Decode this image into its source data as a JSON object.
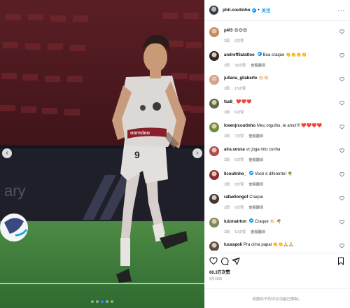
{
  "header": {
    "username": "phil.coutinho",
    "separator": "•",
    "follow_label": "关注",
    "more_label": "···"
  },
  "media": {
    "prev_label": "‹",
    "next_label": "›",
    "slide_count": 5,
    "active_slide": 3,
    "scene_colors": {
      "stands": "#4a1b21",
      "seat": "#7c2a31",
      "pitch": "#3d7a3c",
      "kit": "#d9d6d4",
      "accent": "#8a1f2c"
    }
  },
  "comments": [
    {
      "user": "p4f3",
      "verified": false,
      "text": "😍😍😍",
      "age": "2周",
      "likes": "6次赞",
      "reply": "",
      "avatar_color": "#c98c62"
    },
    {
      "user": "andreffilatattoo",
      "verified": true,
      "text": "Boa craque 👏👏👏👏",
      "age": "2周",
      "likes": "39次赞",
      "reply": "查看翻译",
      "avatar_color": "#2b2b2b"
    },
    {
      "user": "juliana_gilaberte",
      "verified": false,
      "text": "👏🏻👏🏻",
      "age": "2周",
      "likes": "15次赞",
      "reply": "",
      "avatar_color": "#d7a38b"
    },
    {
      "user": "fas8_",
      "verified": false,
      "text": "❤️❤️❤️",
      "age": "2周",
      "likes": "6次赞",
      "reply": "",
      "avatar_color": "#5c6b4a"
    },
    {
      "user": "lovenjrcoutinho",
      "verified": false,
      "text": "Meu orgulho, te amo!!!! ❤️❤️❤️❤️",
      "age": "2周",
      "likes": "7次赞",
      "reply": "查看翻译",
      "avatar_color": "#6f8f3d"
    },
    {
      "user": "aira.sousa",
      "verified": false,
      "text": "vc joga mto cunha",
      "age": "2周",
      "likes": "6次赞",
      "reply": "查看翻译",
      "avatar_color": "#b14a57"
    },
    {
      "user": "llcoutinho_",
      "verified": true,
      "text": "Você é diferente! 🌴",
      "age": "2周",
      "likes": "8次赞",
      "reply": "查看翻译",
      "avatar_color": "#8b2c35"
    },
    {
      "user": "rafaellongof",
      "verified": false,
      "text": "Craque",
      "age": "2周",
      "likes": "6次赞",
      "reply": "查看翻译",
      "avatar_color": "#3a3a3a"
    },
    {
      "user": "luizmairton",
      "verified": true,
      "text": "Craque 👏🏻 🌴",
      "age": "2周",
      "likes": "10次赞",
      "reply": "查看翻译",
      "avatar_color": "#7a8e5a"
    },
    {
      "user": "lucaspoli",
      "verified": false,
      "text": "Pra cima papai 👏👏🙏🙏",
      "age": "",
      "likes": "",
      "reply": "",
      "avatar_color": "#5b4d46"
    }
  ],
  "stats": {
    "likes": "60.3万次赞",
    "date": "4月18日"
  },
  "footer": {
    "text": "该篇帖子的评论功能已限制。"
  }
}
